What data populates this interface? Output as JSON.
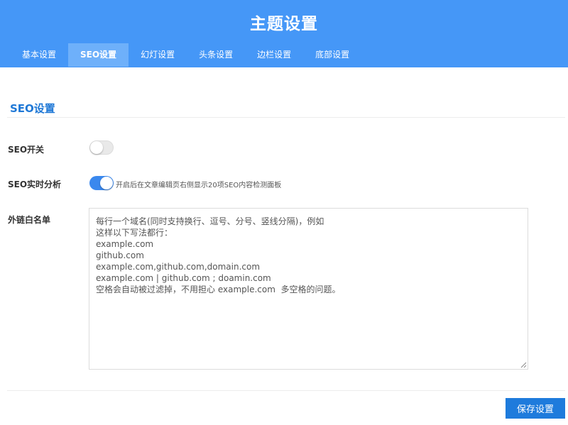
{
  "header": {
    "title": "主题设置",
    "tabs": [
      {
        "label": "基本设置"
      },
      {
        "label": "SEO设置"
      },
      {
        "label": "幻灯设置"
      },
      {
        "label": "头条设置"
      },
      {
        "label": "边栏设置"
      },
      {
        "label": "底部设置"
      }
    ],
    "active_tab": "SEO设置"
  },
  "section": {
    "title": "SEO设置"
  },
  "settings": {
    "seo_switch": {
      "label": "SEO开关",
      "enabled": false
    },
    "seo_realtime": {
      "label": "SEO实时分析",
      "enabled": true,
      "hint": "开启后在文章编辑页右侧显示20项SEO内容检测面板"
    },
    "whitelist": {
      "label": "外链白名单",
      "lines": [
        "每行一个域名(同时支持换行、逗号、分号、竖线分隔)，例如",
        "这样以下写法都行：",
        "example.com",
        "github.com",
        "example.com,github.com,domain.com",
        "example.com | github.com ; doamin.com",
        "空格会自动被过滤掉，不用担心 example.com  多空格的问题。"
      ]
    }
  },
  "footer": {
    "save_label": "保存设置"
  },
  "colors": {
    "header_bg": "#4597f7",
    "active_tab_bg": "#6eb0fa",
    "accent": "#1f78d6",
    "switch_on": "#3a88ee",
    "save_button_bg": "#1e7bdc"
  }
}
